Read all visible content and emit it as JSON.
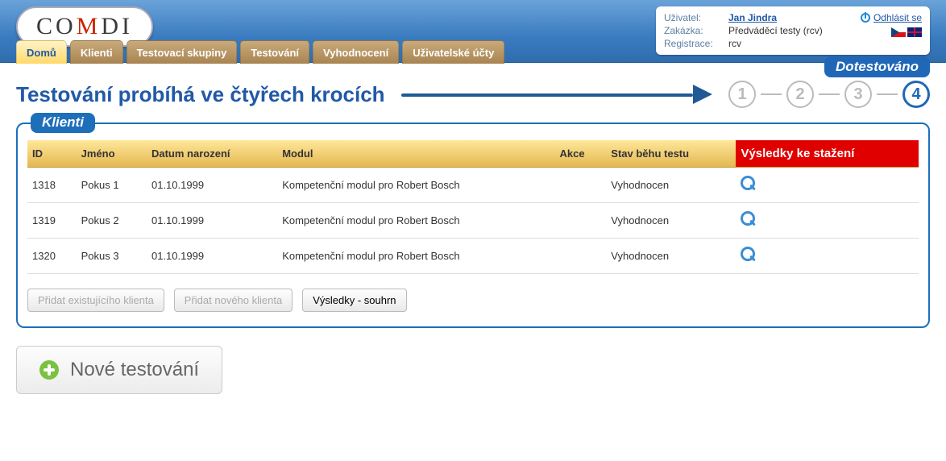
{
  "logo": {
    "text": "COMDI",
    "accent_index": 2
  },
  "info": {
    "user_label": "Uživatel:",
    "user_name": "Jan Jindra",
    "order_label": "Zakázka:",
    "order_value": "Předváděcí testy (rcv)",
    "reg_label": "Registrace:",
    "reg_value": "rcv",
    "logout": "Odhlásit se"
  },
  "tabs": [
    {
      "label": "Domů",
      "active": true
    },
    {
      "label": "Klienti"
    },
    {
      "label": "Testovací skupiny"
    },
    {
      "label": "Testování"
    },
    {
      "label": "Vyhodnocení"
    },
    {
      "label": "Uživatelské účty"
    }
  ],
  "heading": "Testování probíhá ve čtyřech krocích",
  "steps": {
    "tag": "Dotestováno",
    "count": 4,
    "current": 4
  },
  "panel": {
    "title": "Klienti",
    "columns": [
      "ID",
      "Jméno",
      "Datum narození",
      "Modul",
      "Akce",
      "Stav běhu testu",
      "Výsledky ke stažení"
    ],
    "rows": [
      {
        "id": "1318",
        "name": "Pokus 1",
        "dob": "01.10.1999",
        "module": "Kompetenční modul pro Robert Bosch",
        "action": "",
        "status": "Vyhodnocen"
      },
      {
        "id": "1319",
        "name": "Pokus 2",
        "dob": "01.10.1999",
        "module": "Kompetenční modul pro Robert Bosch",
        "action": "",
        "status": "Vyhodnocen"
      },
      {
        "id": "1320",
        "name": "Pokus 3",
        "dob": "01.10.1999",
        "module": "Kompetenční modul pro Robert Bosch",
        "action": "",
        "status": "Vyhodnocen"
      }
    ],
    "buttons": {
      "add_existing": "Přidat existujícího klienta",
      "add_new": "Přidat nového klienta",
      "summary": "Výsledky - souhrn"
    }
  },
  "new_test_btn": "Nové testování"
}
